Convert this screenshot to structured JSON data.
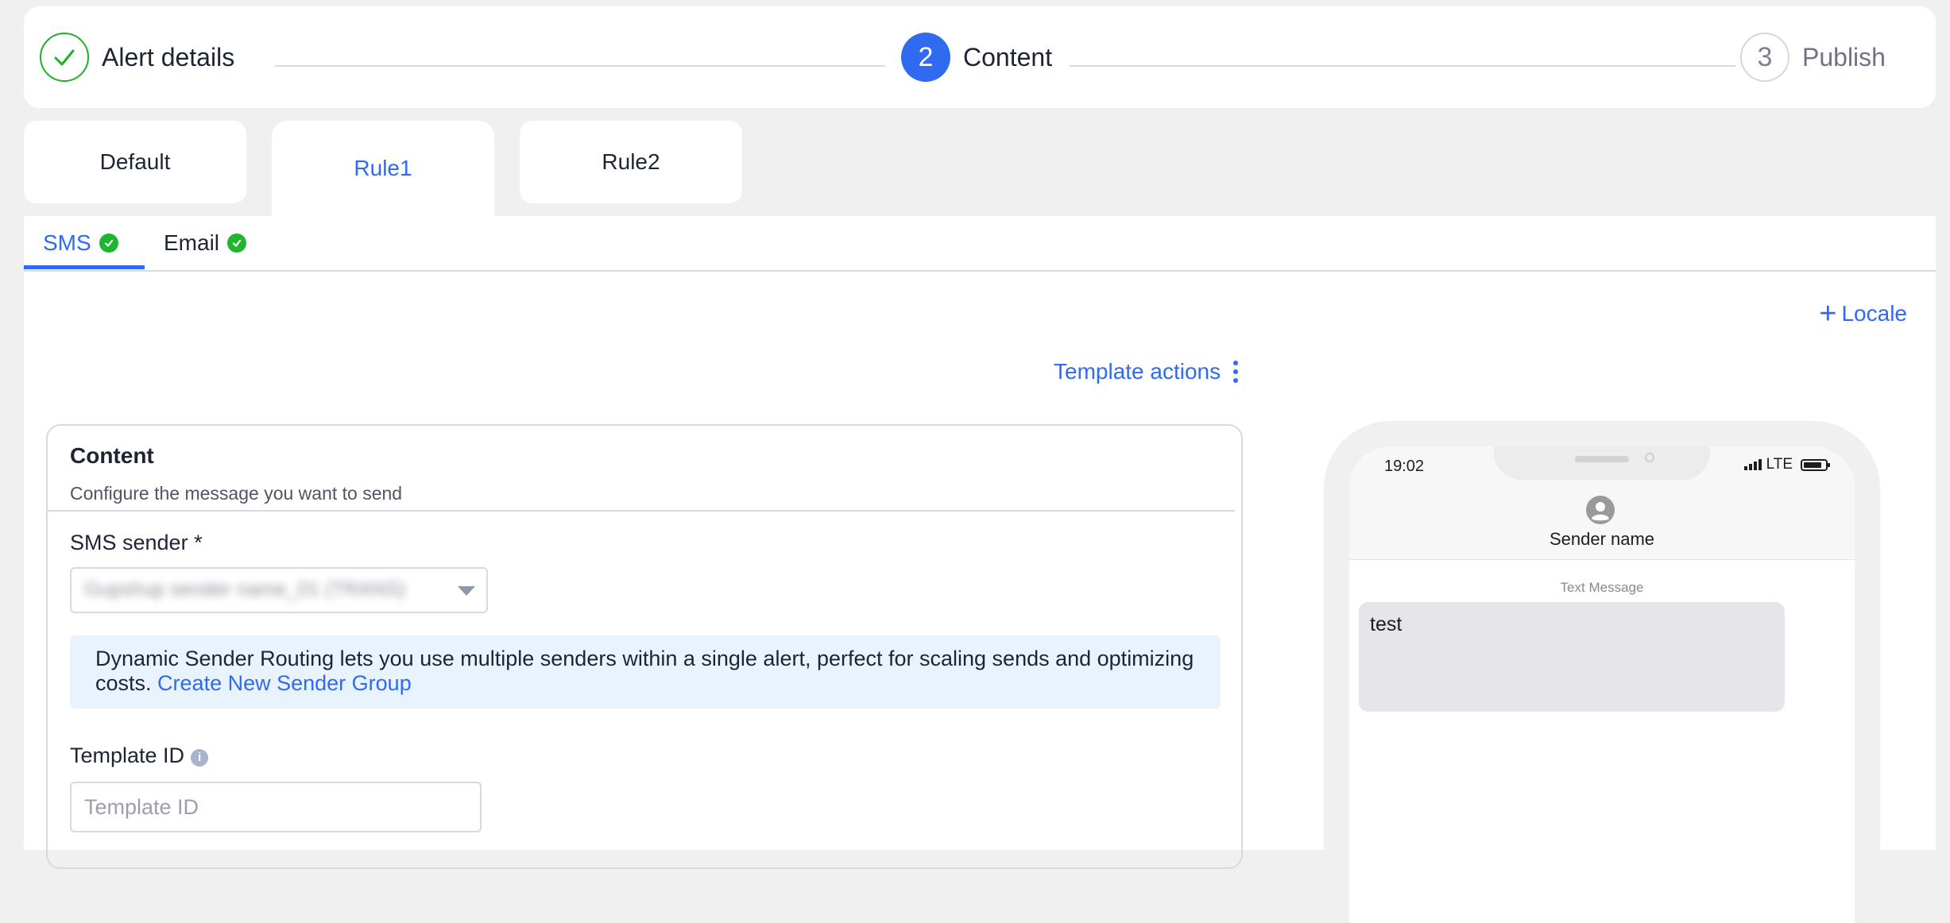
{
  "stepper": {
    "steps": [
      {
        "label": "Alert details",
        "status": "done"
      },
      {
        "label": "Content",
        "number": "2",
        "status": "active"
      },
      {
        "label": "Publish",
        "number": "3",
        "status": "pending"
      }
    ]
  },
  "rule_tabs": [
    {
      "label": "Default",
      "active": false
    },
    {
      "label": "Rule1",
      "active": true
    },
    {
      "label": "Rule2",
      "active": false
    }
  ],
  "channel_tabs": [
    {
      "label": "SMS",
      "active": true,
      "status_icon": "check-circle-icon"
    },
    {
      "label": "Email",
      "active": false,
      "status_icon": "check-circle-icon"
    }
  ],
  "locale_link": "Locale",
  "template_actions": "Template actions",
  "content": {
    "title": "Content",
    "subtitle": "Configure the message you want to send",
    "sms_sender": {
      "label": "SMS sender",
      "required_mark": "*",
      "value": "Gupshup sender name_01 (TRANS)"
    },
    "banner": {
      "text": "Dynamic Sender Routing lets you use multiple senders within a single alert, perfect for scaling sends and optimizing costs.",
      "link": "Create New Sender Group"
    },
    "template_id": {
      "label": "Template ID",
      "placeholder": "Template ID",
      "value": ""
    }
  },
  "preview": {
    "time": "19:02",
    "network": "LTE",
    "sender_name": "Sender name",
    "message_type": "Text Message",
    "message": "test"
  },
  "colors": {
    "accent": "#2f6bf0",
    "success": "#1eb52f",
    "background": "#f0f0f0",
    "banner": "#e8f3fd"
  }
}
